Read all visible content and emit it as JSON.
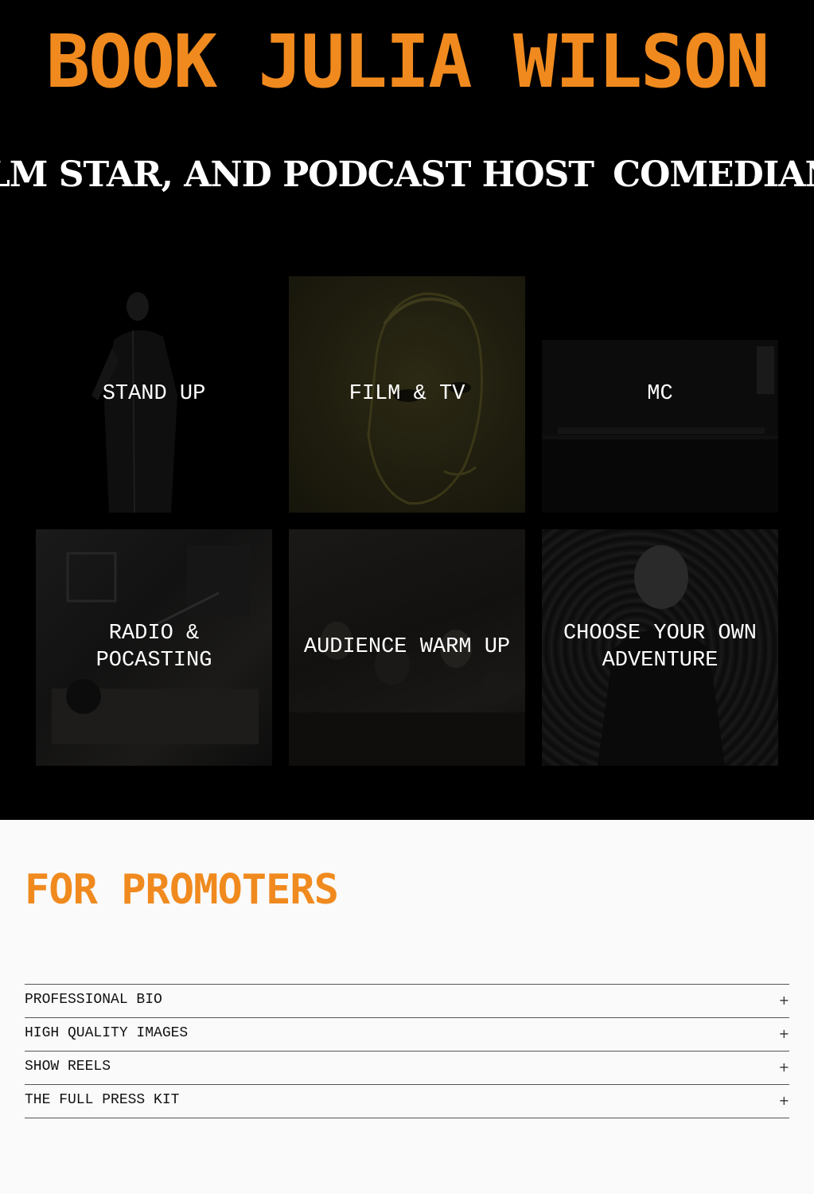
{
  "hero": {
    "title": "BOOK JULIA WILSON",
    "marquee": [
      "FILM STAR, AND PODCAST HOST",
      "COMEDIAN, FILM STAR, AND PODCAST HOST"
    ]
  },
  "tiles": [
    {
      "label": "STAND UP"
    },
    {
      "label": "FILM & TV"
    },
    {
      "label": "MC"
    },
    {
      "label": "RADIO & POCASTING"
    },
    {
      "label": "AUDIENCE WARM UP"
    },
    {
      "label": "CHOOSE YOUR OWN ADVENTURE"
    }
  ],
  "promoters": {
    "title": "FOR PROMOTERS",
    "items": [
      {
        "label": "PROFESSIONAL BIO",
        "icon": "+"
      },
      {
        "label": "HIGH QUALITY IMAGES",
        "icon": "+"
      },
      {
        "label": "SHOW REELS",
        "icon": "+"
      },
      {
        "label": "THE FULL PRESS KIT",
        "icon": "+"
      }
    ]
  },
  "colors": {
    "accent": "#f08a1e",
    "hero_bg": "#000000",
    "page_bg": "#fafafa"
  }
}
